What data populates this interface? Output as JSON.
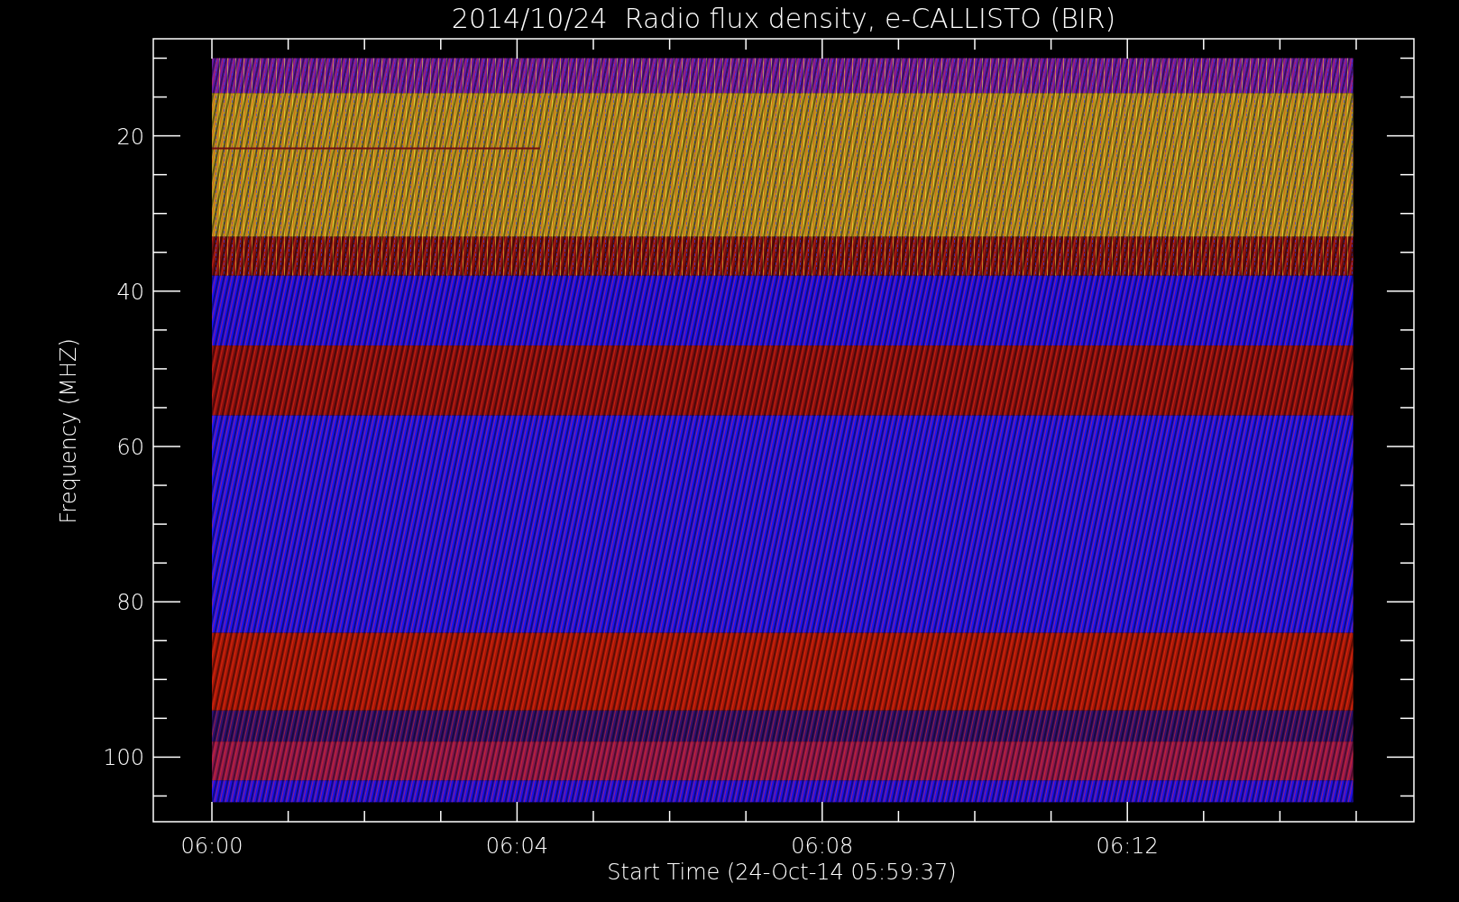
{
  "chart_title": "2014/10/24  Radio flux density, e-CALLISTO (BIR)",
  "y_axis": {
    "label": "Frequency (MHZ)",
    "ticks": [
      "20",
      "40",
      "60",
      "80",
      "100"
    ]
  },
  "x_axis": {
    "label": "Start Time (24-Oct-14 05:59:37)",
    "ticks": [
      "06:00",
      "06:04",
      "06:08",
      "06:12"
    ]
  }
}
